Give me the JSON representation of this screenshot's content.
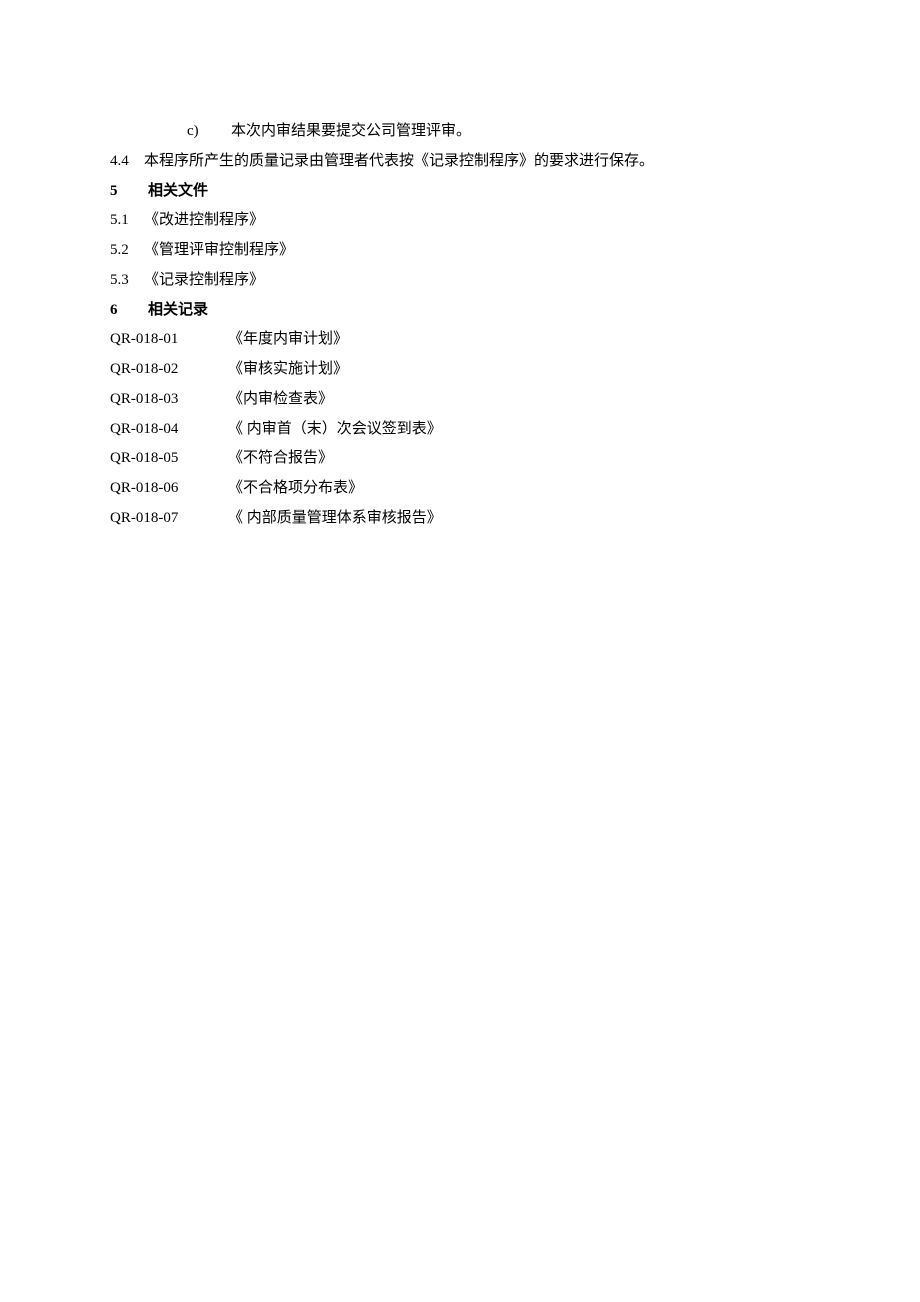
{
  "content": {
    "line_c": {
      "label": "c)",
      "text": "本次内审结果要提交公司管理评审。"
    },
    "line_44": {
      "label": "4.4",
      "text": "本程序所产生的质量记录由管理者代表按《记录控制程序》的要求进行保存。"
    },
    "section5": {
      "label": "5",
      "title": "相关文件",
      "items": [
        {
          "label": "5.1",
          "text": "《改进控制程序》"
        },
        {
          "label": "5.2",
          "text": "《管理评审控制程序》"
        },
        {
          "label": "5.3",
          "text": "《记录控制程序》"
        }
      ]
    },
    "section6": {
      "label": "6",
      "title": "相关记录",
      "records": [
        {
          "code": "QR-018-01",
          "name": "《年度内审计划》"
        },
        {
          "code": "QR-018-02",
          "name": "《审核实施计划》"
        },
        {
          "code": "QR-018-03",
          "name": "《内审检查表》"
        },
        {
          "code": "QR-018-04",
          "name": "《 内审首（末）次会议签到表》"
        },
        {
          "code": "QR-018-05",
          "name": "《不符合报告》"
        },
        {
          "code": "QR-018-06",
          "name": "《不合格项分布表》"
        },
        {
          "code": "QR-018-07",
          "name": "《 内部质量管理体系审核报告》"
        }
      ]
    }
  }
}
